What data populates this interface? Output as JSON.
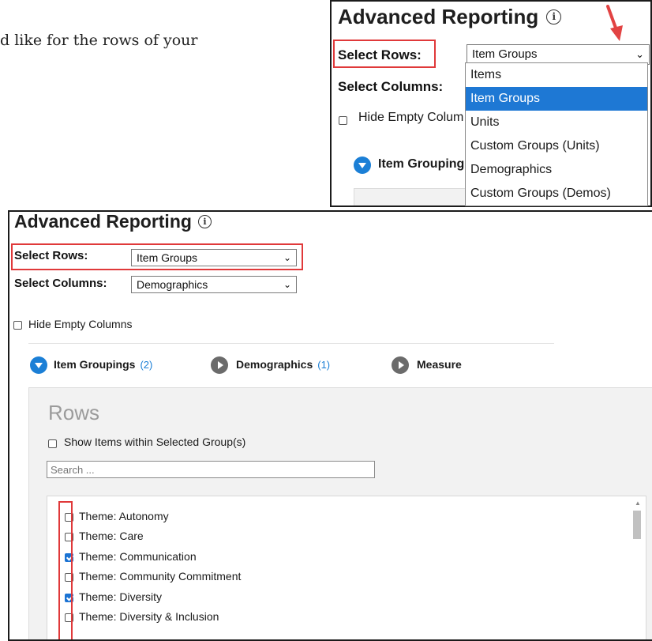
{
  "intro_text": "d like for the rows of your",
  "top_panel": {
    "title": "Advanced Reporting",
    "info_glyph": "i",
    "select_rows_label": "Select Rows:",
    "select_rows_value": "Item Groups",
    "select_columns_label": "Select Columns:",
    "hide_empty_label": "Hide Empty Colum",
    "item_groupings_label": "Item Grouping",
    "dropdown_options": [
      "Items",
      "Item Groups",
      "Units",
      "Custom Groups (Units)",
      "Demographics",
      "Custom Groups (Demos)"
    ],
    "dropdown_selected": "Item Groups"
  },
  "main_panel": {
    "title": "Advanced Reporting",
    "info_glyph": "i",
    "select_rows_label": "Select Rows:",
    "select_rows_value": "Item Groups",
    "select_columns_label": "Select Columns:",
    "select_columns_value": "Demographics",
    "hide_empty_label": "Hide Empty Columns",
    "tabs": [
      {
        "label": "Item Groupings",
        "count": "(2)",
        "state": "expanded"
      },
      {
        "label": "Demographics",
        "count": "(1)",
        "state": "collapsed"
      },
      {
        "label": "Measure",
        "count": "",
        "state": "collapsed"
      }
    ],
    "rows_title": "Rows",
    "show_items_label": "Show Items within Selected Group(s)",
    "search_placeholder": "Search ...",
    "items": [
      {
        "label": "Theme: Autonomy",
        "checked": false
      },
      {
        "label": "Theme: Care",
        "checked": false
      },
      {
        "label": "Theme: Communication",
        "checked": true
      },
      {
        "label": "Theme: Community Commitment",
        "checked": false
      },
      {
        "label": "Theme: Diversity",
        "checked": true
      },
      {
        "label": "Theme: Diversity & Inclusion",
        "checked": false
      }
    ]
  },
  "colors": {
    "highlight_red": "#e0393a",
    "accent_blue": "#1e78d4",
    "tab_gray": "#6b6b6b",
    "rows_bg": "#f2f2f2"
  },
  "chevron": "⌄"
}
